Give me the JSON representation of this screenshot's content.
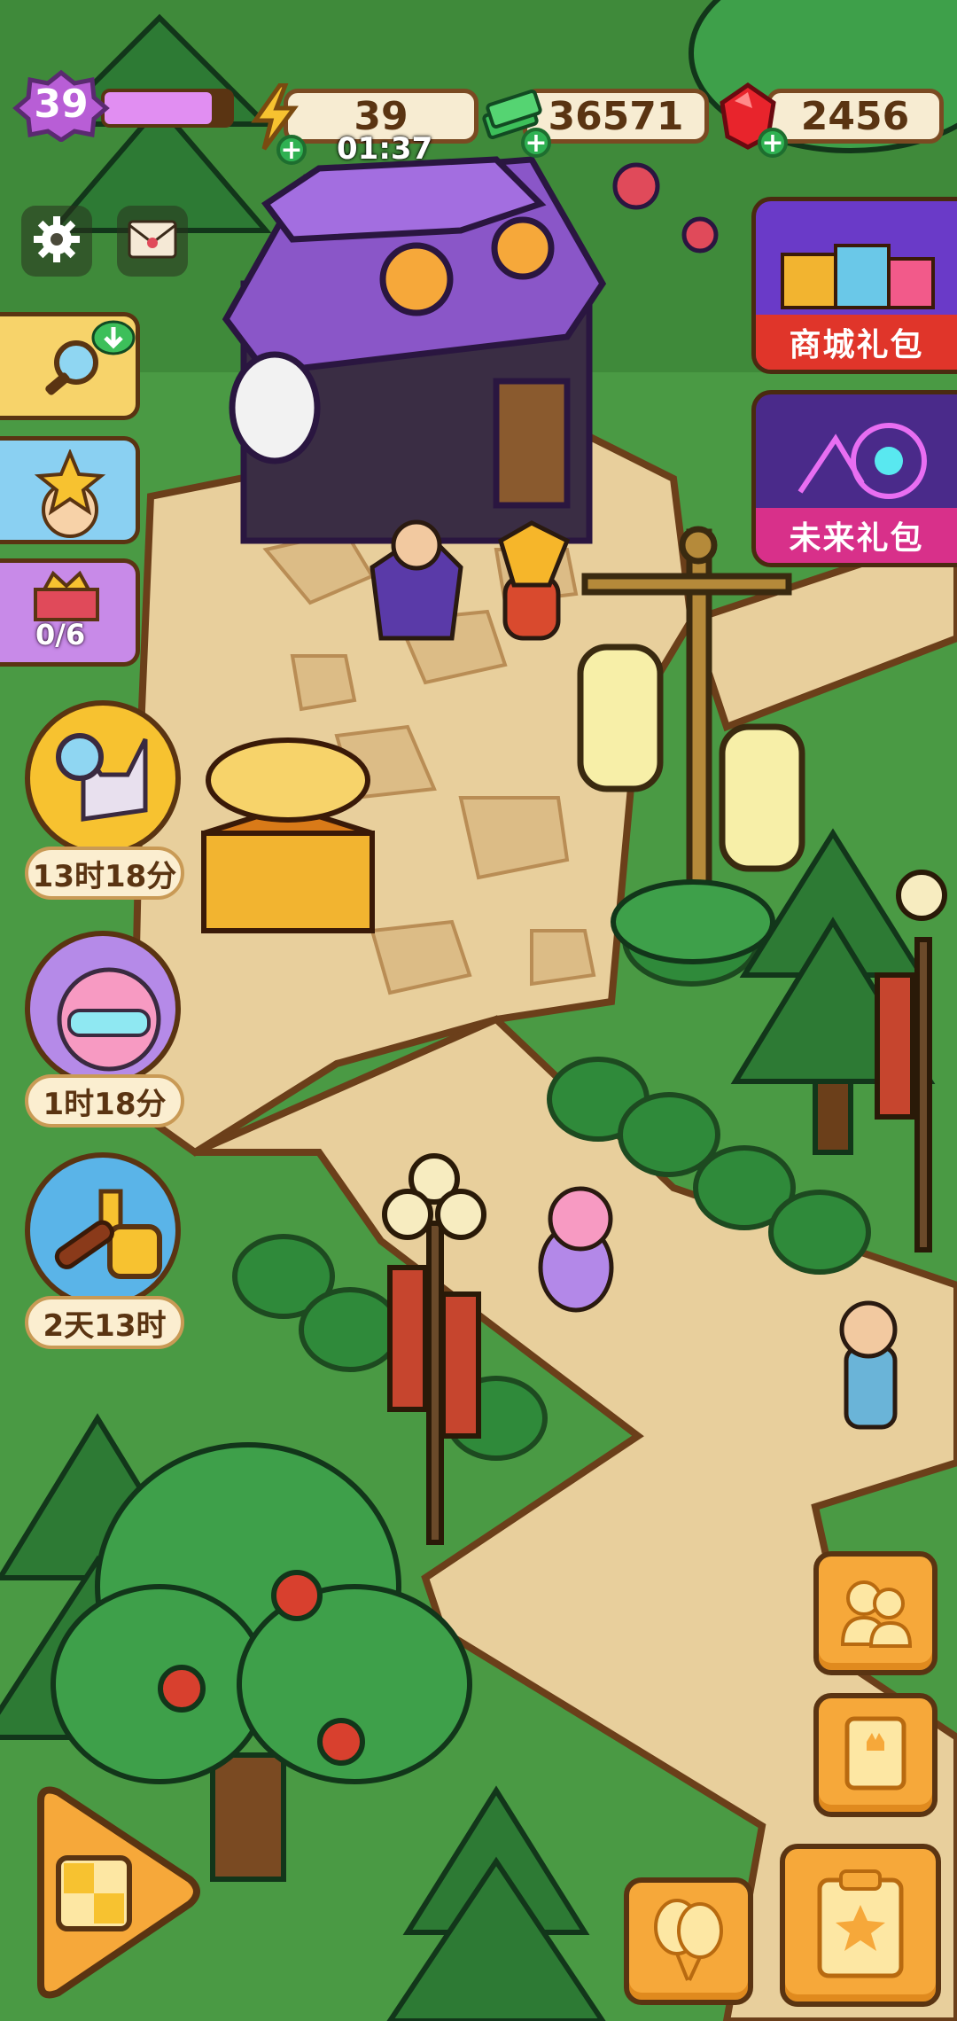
{
  "hud": {
    "level": "39",
    "energy": "39",
    "energy_timer": "01:37",
    "cash": "36571",
    "gems": "2456"
  },
  "promos": {
    "shop_pack": "商城礼包",
    "future_pack": "未来礼包"
  },
  "side": {
    "task_progress": "0/6",
    "event_timers": [
      "13时18分",
      "1时18分",
      "2天13时"
    ]
  },
  "colors": {
    "grass": "#3f8a3a",
    "path": "#e8cf9c",
    "accent_orange": "#f6a83a",
    "hud_brown": "#7a4a22",
    "level_purple": "#b85ed6"
  },
  "icons": {
    "level": "purple-flower-badge-icon",
    "energy": "lightning-icon",
    "cash": "cash-stack-icon",
    "gem": "red-gem-icon",
    "settings": "gear-icon",
    "mail": "envelope-icon",
    "friends": "friends-icon",
    "book": "book-icon",
    "tasks": "clipboard-star-icon",
    "balloons": "balloons-icon",
    "shop_arrow": "checker-arrow-icon"
  }
}
